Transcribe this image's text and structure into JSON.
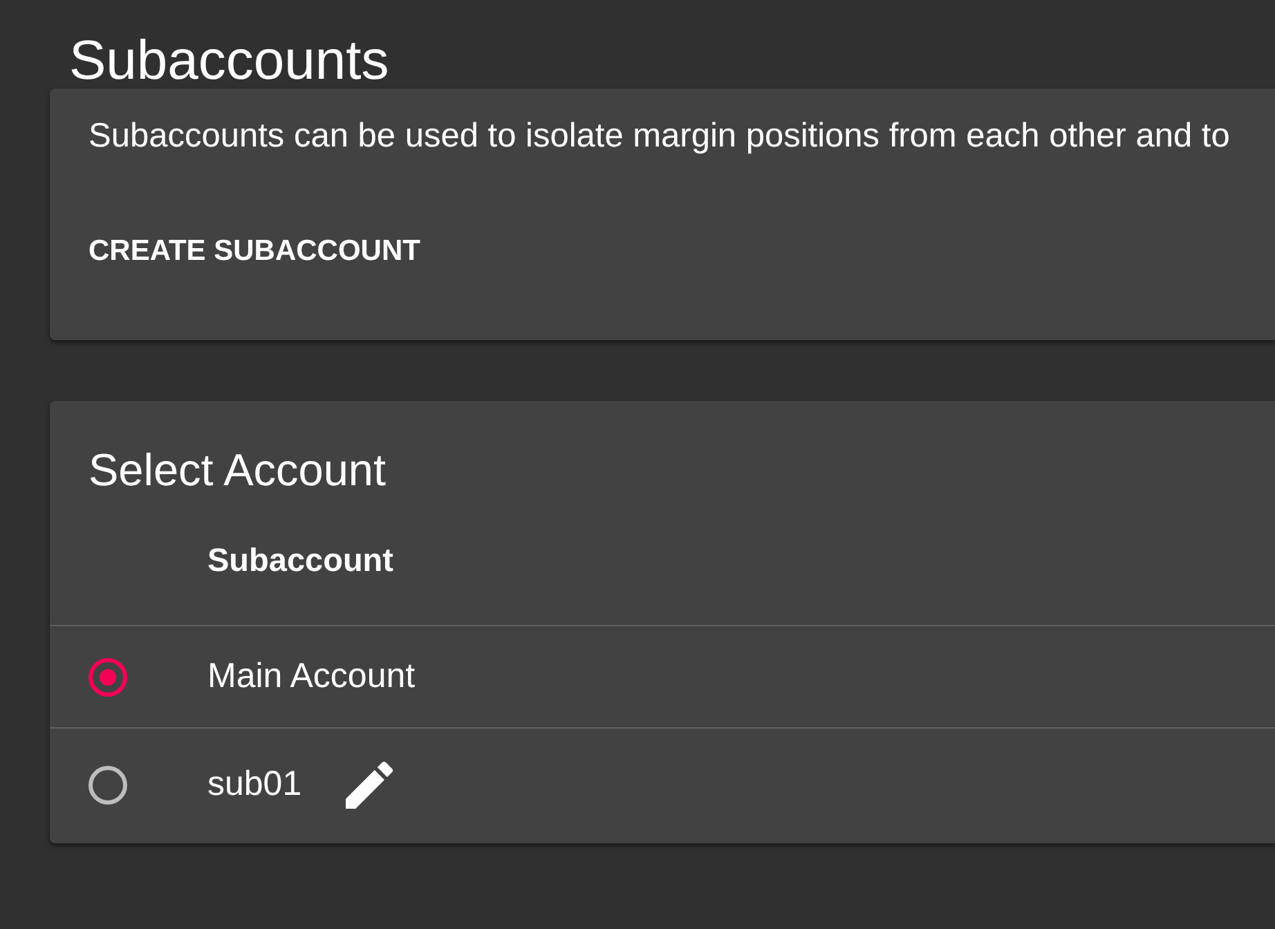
{
  "page": {
    "title": "Subaccounts"
  },
  "info_card": {
    "description": "Subaccounts can be used to isolate margin positions from each other and to",
    "button": "CREATE SUBACCOUNT"
  },
  "account_card": {
    "title": "Select Account",
    "columns": [
      "Subaccount"
    ],
    "rows": [
      {
        "name": "Main Account",
        "selected": true,
        "editable": false
      },
      {
        "name": "sub01",
        "selected": false,
        "editable": true
      }
    ]
  }
}
